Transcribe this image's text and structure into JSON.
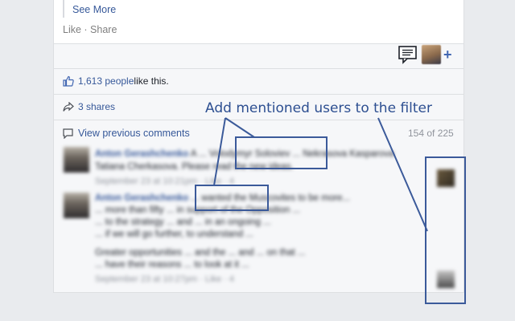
{
  "post": {
    "see_more": "See More",
    "like": "Like",
    "dot": " · ",
    "share": "Share"
  },
  "stats": {
    "likes_count": "1,613 people",
    "likes_suffix": " like this.",
    "shares": "3 shares",
    "view_previous": "View previous comments",
    "pagination": "154 of 225"
  },
  "annotation": {
    "text": "Add mentioned users to the filter"
  },
  "comments": [
    {
      "author": "Anton Gerashchenko",
      "mention": "Volodymyr Soloviev",
      "line1": "A ... Volodymyr Soloviev ... Nekrasova Kasparova",
      "line2": "Tatiana Cherkasova. Please read the new ideas.",
      "meta": "September 23 at 10:21pm · Like · 4"
    },
    {
      "author": "Anton Gerashchenko",
      "mention": "Danyil Shulgin",
      "line1": "... wanted the Muscovites to be more...",
      "line2": "... more than fifty ... in support of the Opposition ...",
      "line3": "... to the strategy ... and ... in an ongoing ...",
      "line4": "... if we will go further, to understand ...",
      "line5": "Greater opportunities ... and the ... and ... on that ...",
      "line6": "... have their reasons ... to look at it ...",
      "meta": "September 23 at 10:27pm · Like · 4"
    }
  ],
  "colors": {
    "link": "#365899",
    "annotation": "#2d4f91",
    "page_bg": "#e9ebee"
  }
}
